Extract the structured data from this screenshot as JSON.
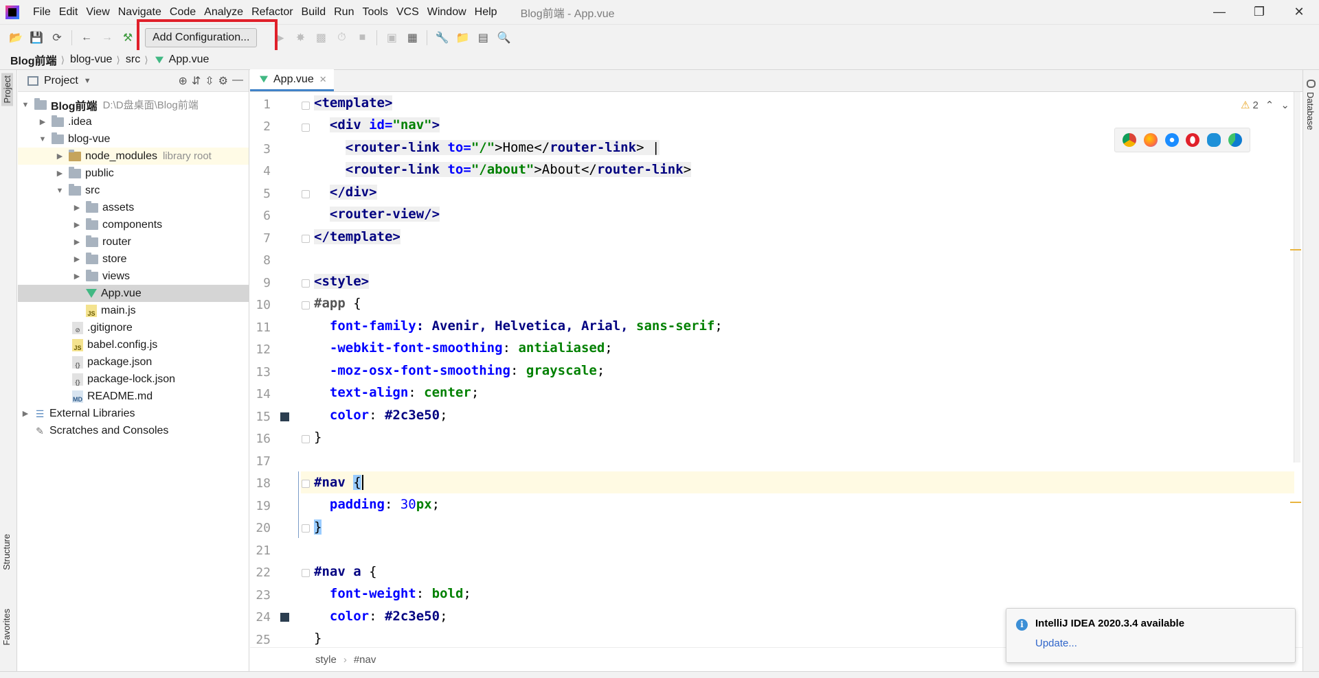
{
  "titlebar": {
    "menus": [
      "File",
      "Edit",
      "View",
      "Navigate",
      "Code",
      "Analyze",
      "Refactor",
      "Build",
      "Run",
      "Tools",
      "VCS",
      "Window",
      "Help"
    ],
    "window_title": "Blog前端 - App.vue"
  },
  "toolbar": {
    "add_config_label": "Add Configuration..."
  },
  "breadcrumb": [
    "Blog前端",
    "blog-vue",
    "src",
    "App.vue"
  ],
  "left_strip": {
    "project_tab": "Project",
    "structure_tab": "Structure",
    "favorites_tab": "Favorites"
  },
  "right_strip": {
    "database_tab": "Database"
  },
  "project_panel": {
    "title": "Project",
    "tree": [
      {
        "label": "Blog前端",
        "extra": "D:\\D盘桌面\\Blog前端"
      },
      {
        "label": ".idea"
      },
      {
        "label": "blog-vue"
      },
      {
        "label": "node_modules",
        "extra": "library root"
      },
      {
        "label": "public"
      },
      {
        "label": "src"
      },
      {
        "label": "assets"
      },
      {
        "label": "components"
      },
      {
        "label": "router"
      },
      {
        "label": "store"
      },
      {
        "label": "views"
      },
      {
        "label": "App.vue"
      },
      {
        "label": "main.js"
      },
      {
        "label": ".gitignore"
      },
      {
        "label": "babel.config.js"
      },
      {
        "label": "package.json"
      },
      {
        "label": "package-lock.json"
      },
      {
        "label": "README.md"
      },
      {
        "label": "External Libraries"
      },
      {
        "label": "Scratches and Consoles"
      }
    ]
  },
  "editor": {
    "tab_label": "App.vue",
    "line_numbers": [
      "1",
      "2",
      "3",
      "4",
      "5",
      "6",
      "7",
      "8",
      "9",
      "10",
      "11",
      "12",
      "13",
      "14",
      "15",
      "16",
      "17",
      "18",
      "19",
      "20",
      "21",
      "22",
      "23",
      "24",
      "25"
    ],
    "warnings_count": "2",
    "code": {
      "l1": "<template>",
      "l2_tag": "<div ",
      "l2_attr": "id=",
      "l2_str": "\"nav\"",
      "l2_end": ">",
      "l3_tag": "<router-link ",
      "l3_attr": "to=",
      "l3_str": "\"/\"",
      "l3_text": ">Home</",
      "l3_close": "router-link",
      "l3_end": "> |",
      "l4_tag": "<router-link ",
      "l4_attr": "to=",
      "l4_str": "\"/about\"",
      "l4_text": ">About</",
      "l4_close": "router-link",
      "l4_end": ">",
      "l5": "</div>",
      "l6": "<router-view/>",
      "l7": "</template>",
      "l9": "<style>",
      "l10_sel": "#app",
      "l10_end": " {",
      "l11_prop": "font-family",
      "l11_vals": ": Avenir, Helvetica, Arial, ",
      "l11_val2": "sans-serif",
      "l11_end": ";",
      "l12_prop": "-webkit-font-smoothing",
      "l12_val": "antialiased",
      "l13_prop": "-moz-osx-font-smoothing",
      "l13_val": "grayscale",
      "l14_prop": "text-align",
      "l14_val": "center",
      "l15_prop": "color",
      "l15_val": "#2c3e50",
      "l16": "}",
      "l18_sel": "#nav ",
      "l18_brace": "{",
      "l19_prop": "padding",
      "l19_num": "30",
      "l19_unit": "px",
      "l20": "}",
      "l22_sel": "#nav a",
      "l22_end": " {",
      "l23_prop": "font-weight",
      "l23_val": "bold",
      "l24_prop": "color",
      "l24_val": "#2c3e50",
      "l25": "}"
    }
  },
  "editor_crumbs": [
    "style",
    "#nav"
  ],
  "notification": {
    "title": "IntelliJ IDEA 2020.3.4 available",
    "link": "Update..."
  },
  "colors": {
    "swatch": "#2c3e50",
    "highlight_box": "#e0202a",
    "accent": "#4083c9"
  }
}
